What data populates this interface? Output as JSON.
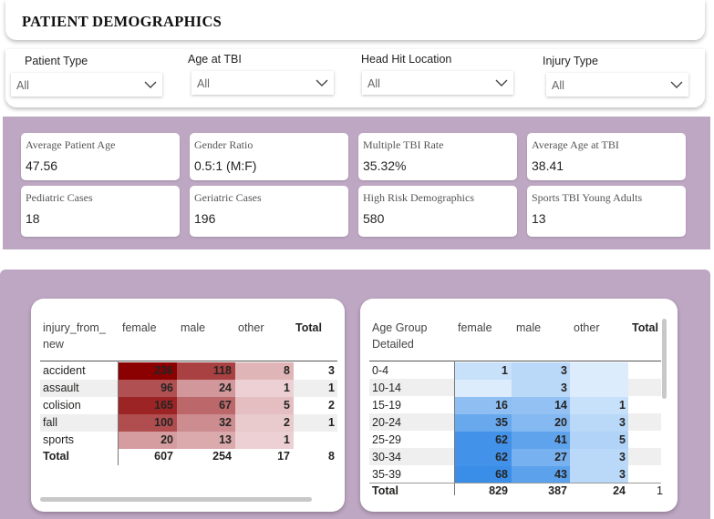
{
  "header": {
    "title": "PATIENT DEMOGRAPHICS"
  },
  "filters": [
    {
      "label": "Patient Type",
      "value": "All"
    },
    {
      "label": "Age at TBI",
      "value": "All"
    },
    {
      "label": "Head Hit Location",
      "value": "All"
    },
    {
      "label": "Injury Type",
      "value": "All"
    }
  ],
  "kpis": [
    {
      "label": "Average Patient Age",
      "value": "47.56"
    },
    {
      "label": "Gender Ratio",
      "value": "0.5:1 (M:F)"
    },
    {
      "label": "Multiple TBI Rate",
      "value": "35.32%"
    },
    {
      "label": "Average Age at TBI",
      "value": "38.41"
    },
    {
      "label": "Pediatric Cases",
      "value": "18"
    },
    {
      "label": "Geriatric Cases",
      "value": "196"
    },
    {
      "label": "High Risk Demographics",
      "value": "580"
    },
    {
      "label": "Sports TBI Young Adults",
      "value": "13"
    }
  ],
  "colors": {
    "band": "#bea7c3",
    "heat_red_max": "#8b0000",
    "heat_blue_max": "#3b8ee8"
  },
  "injury_matrix": {
    "row_header_line1": "injury_from_",
    "row_header_line2": "new",
    "columns": [
      "female",
      "male",
      "other",
      "Total"
    ],
    "rows": [
      {
        "label": "accident",
        "female": "236",
        "male": "118",
        "other": "8",
        "total": "3"
      },
      {
        "label": "assault",
        "female": "96",
        "male": "24",
        "other": "1",
        "total": "1"
      },
      {
        "label": "colision",
        "female": "165",
        "male": "67",
        "other": "5",
        "total": "2"
      },
      {
        "label": "fall",
        "female": "100",
        "male": "32",
        "other": "2",
        "total": "1"
      },
      {
        "label": "sports",
        "female": "20",
        "male": "13",
        "other": "1",
        "total": ""
      }
    ],
    "total_row": {
      "label": "Total",
      "female": "607",
      "male": "254",
      "other": "17",
      "total": "8"
    }
  },
  "age_matrix": {
    "row_header_line1": "Age Group",
    "row_header_line2": "Detailed",
    "columns": [
      "female",
      "male",
      "other",
      "Total"
    ],
    "rows": [
      {
        "label": "0-4",
        "female": "1",
        "male": "3",
        "other": ""
      },
      {
        "label": "10-14",
        "female": "",
        "male": "3",
        "other": ""
      },
      {
        "label": "15-19",
        "female": "16",
        "male": "14",
        "other": "1"
      },
      {
        "label": "20-24",
        "female": "35",
        "male": "20",
        "other": "3"
      },
      {
        "label": "25-29",
        "female": "62",
        "male": "41",
        "other": "5"
      },
      {
        "label": "30-34",
        "female": "62",
        "male": "27",
        "other": "3"
      },
      {
        "label": "35-39",
        "female": "68",
        "male": "43",
        "other": "3"
      }
    ],
    "total_row": {
      "label": "Total",
      "female": "829",
      "male": "387",
      "other": "24",
      "total": "1"
    }
  }
}
